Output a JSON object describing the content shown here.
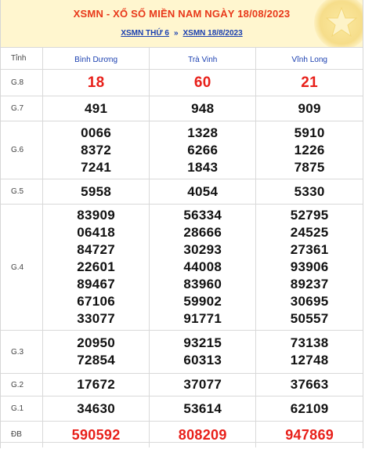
{
  "header": {
    "title": "XSMN - XỔ SỐ MIỀN NAM NGÀY 18/08/2023",
    "link_day": "XSMN THỨ 6",
    "separator": "»",
    "link_date": "XSMN 18/8/2023"
  },
  "table": {
    "col_header": "Tỉnh",
    "provinces": [
      "Bình Dương",
      "Trà Vinh",
      "Vĩnh Long"
    ],
    "rows": [
      {
        "label": "G.8",
        "values": [
          [
            "18"
          ],
          [
            "60"
          ],
          [
            "21"
          ]
        ]
      },
      {
        "label": "G.7",
        "values": [
          [
            "491"
          ],
          [
            "948"
          ],
          [
            "909"
          ]
        ]
      },
      {
        "label": "G.6",
        "values": [
          [
            "0066",
            "8372",
            "7241"
          ],
          [
            "1328",
            "6266",
            "1843"
          ],
          [
            "5910",
            "1226",
            "7875"
          ]
        ]
      },
      {
        "label": "G.5",
        "values": [
          [
            "5958"
          ],
          [
            "4054"
          ],
          [
            "5330"
          ]
        ]
      },
      {
        "label": "G.4",
        "values": [
          [
            "83909",
            "06418",
            "84727",
            "22601",
            "89467",
            "67106",
            "33077"
          ],
          [
            "56334",
            "28666",
            "30293",
            "44008",
            "83960",
            "59902",
            "91771"
          ],
          [
            "52795",
            "24525",
            "27361",
            "93906",
            "89237",
            "30695",
            "50557"
          ]
        ]
      },
      {
        "label": "G.3",
        "values": [
          [
            "20950",
            "72854"
          ],
          [
            "93215",
            "60313"
          ],
          [
            "73138",
            "12748"
          ]
        ]
      },
      {
        "label": "G.2",
        "values": [
          [
            "17672"
          ],
          [
            "37077"
          ],
          [
            "37663"
          ]
        ]
      },
      {
        "label": "G.1",
        "values": [
          [
            "34630"
          ],
          [
            "53614"
          ],
          [
            "62109"
          ]
        ]
      },
      {
        "label": "ĐB",
        "values": [
          [
            "590592"
          ],
          [
            "808209"
          ],
          [
            "947869"
          ]
        ]
      }
    ]
  },
  "colors": {
    "accent_red": "#e8201a",
    "link_blue": "#1a3fb0",
    "header_bg": "#fff6cf"
  }
}
